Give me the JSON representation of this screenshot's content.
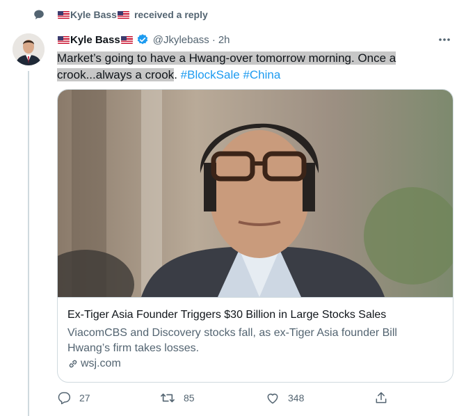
{
  "context": {
    "name": "Kyle Bass",
    "text": "received a reply"
  },
  "tweet": {
    "display_name": "Kyle Bass",
    "handle": "@Jkylebass",
    "separator": "·",
    "time": "2h",
    "text_highlighted": "Market’s going to have a Hwang-over tomorrow morning. Once a crook...always a crook",
    "text_period": ".",
    "hashtag1": "#BlockSale",
    "hashtag2": "#China"
  },
  "card": {
    "title": "Ex-Tiger Asia Founder Triggers $30 Billion in Large Stocks Sales",
    "description": "ViacomCBS and Discovery stocks fall, as ex-Tiger Asia founder Bill Hwang’s firm takes losses.",
    "domain": "wsj.com"
  },
  "actions": {
    "replies": "27",
    "retweets": "85",
    "likes": "348"
  },
  "icons": [
    "reply-context-icon",
    "verified-badge-icon",
    "more-options-icon",
    "link-icon",
    "reply-icon",
    "retweet-icon",
    "like-icon",
    "share-icon"
  ],
  "colors": {
    "accent": "#1d9bf0",
    "secondary_text": "#536471",
    "border": "#cfd9de",
    "highlight": "#c7c7c7"
  }
}
